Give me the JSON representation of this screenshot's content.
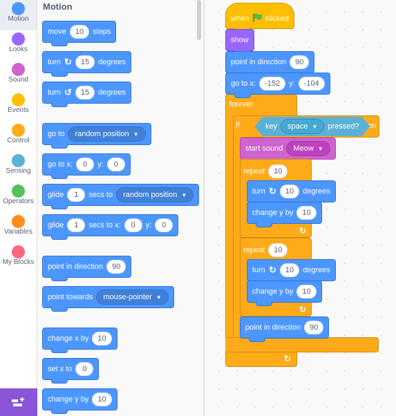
{
  "categories": [
    {
      "label": "Motion",
      "color": "#4c97ff",
      "selected": true
    },
    {
      "label": "Looks",
      "color": "#9966ff",
      "selected": false
    },
    {
      "label": "Sound",
      "color": "#cf63cf",
      "selected": false
    },
    {
      "label": "Events",
      "color": "#ffbf00",
      "selected": false
    },
    {
      "label": "Control",
      "color": "#ffab19",
      "selected": false
    },
    {
      "label": "Sensing",
      "color": "#5cb1d6",
      "selected": false
    },
    {
      "label": "Operators",
      "color": "#59c059",
      "selected": false
    },
    {
      "label": "Variables",
      "color": "#ff8c1a",
      "selected": false
    },
    {
      "label": "My Blocks",
      "color": "#ff6680",
      "selected": false
    }
  ],
  "extension_button": {
    "icon": "add-extension-icon"
  },
  "palette": {
    "title": "Motion",
    "blocks": {
      "move": {
        "pre": "move",
        "value": "10",
        "post": "steps"
      },
      "turn_right": {
        "pre": "turn",
        "icon": "↻",
        "value": "15",
        "post": "degrees"
      },
      "turn_left": {
        "pre": "turn",
        "icon": "↺",
        "value": "15",
        "post": "degrees"
      },
      "go_to": {
        "pre": "go to",
        "dropdown": "random position"
      },
      "go_to_xy": {
        "pre": "go to x:",
        "x": "0",
        "mid": "y:",
        "y": "0"
      },
      "glide_to": {
        "pre": "glide",
        "value": "1",
        "mid": "secs to",
        "dropdown": "random position"
      },
      "glide_xy": {
        "pre": "glide",
        "value": "1",
        "mid": "secs to x:",
        "x": "0",
        "mid2": "y:",
        "y": "0"
      },
      "point_dir": {
        "pre": "point in direction",
        "value": "90"
      },
      "point_towards": {
        "pre": "point towards",
        "dropdown": "mouse-pointer"
      },
      "change_x": {
        "pre": "change x by",
        "value": "10"
      },
      "set_x": {
        "pre": "set x to",
        "value": "0"
      },
      "change_y": {
        "pre": "change y by",
        "value": "10"
      }
    }
  },
  "script": {
    "hat": {
      "pre": "when",
      "icon": "green-flag",
      "post": "clicked"
    },
    "show": {
      "label": "show"
    },
    "point_dir": {
      "pre": "point in direction",
      "value": "90"
    },
    "go_to_xy": {
      "pre": "go to x:",
      "x": "-152",
      "mid": "y:",
      "y": "-104"
    },
    "forever": {
      "label": "forever"
    },
    "if": {
      "pre": "if",
      "post": "then",
      "cond_pre": "key",
      "cond_dropdown": "space",
      "cond_post": "pressed?"
    },
    "start_sound": {
      "pre": "start sound",
      "dropdown": "Meow"
    },
    "repeat1": {
      "pre": "repeat",
      "value": "10",
      "turn": {
        "pre": "turn",
        "icon": "↻",
        "value": "10",
        "post": "degrees"
      },
      "change_y": {
        "pre": "change y by",
        "value": "10"
      }
    },
    "repeat2": {
      "pre": "repeat",
      "value": "10",
      "turn": {
        "pre": "turn",
        "icon": "↻",
        "value": "10",
        "post": "degrees"
      },
      "change_y": {
        "pre": "change y by",
        "value": "10"
      }
    },
    "point_dir2": {
      "pre": "point in direction",
      "value": "90"
    },
    "loop_arrow": "↻"
  }
}
